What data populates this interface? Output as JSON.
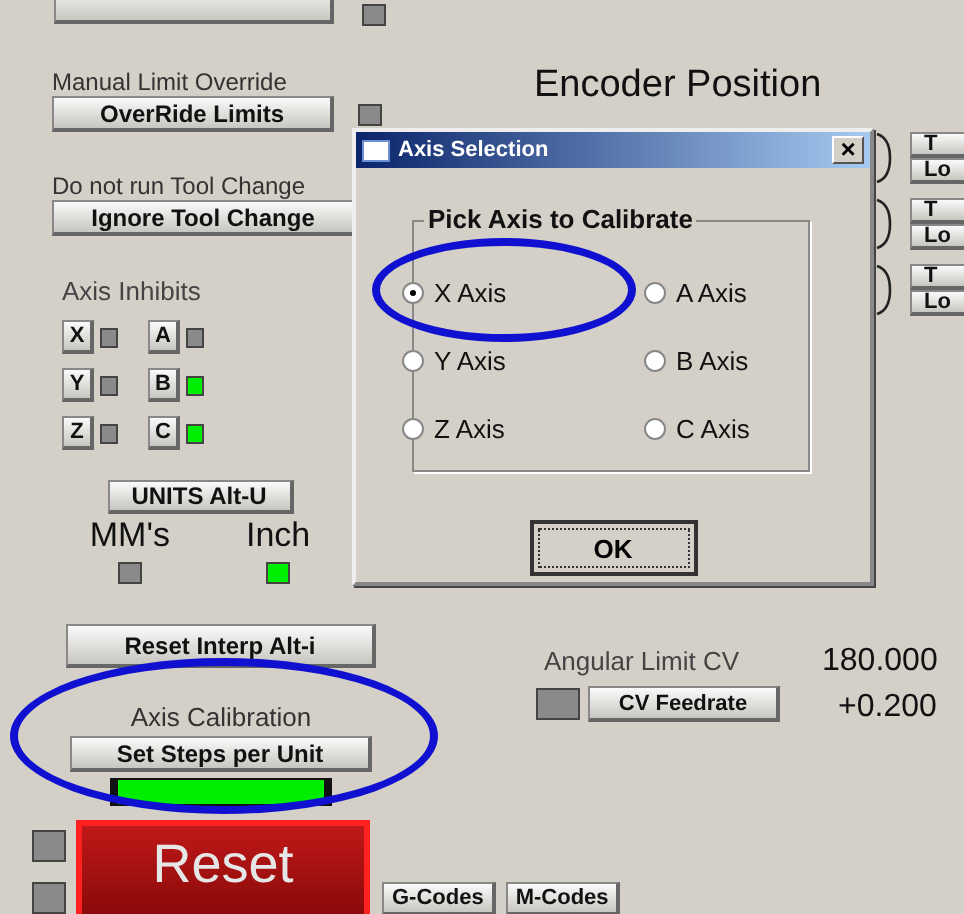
{
  "top_led": {
    "on": false
  },
  "limit_override": {
    "label": "Manual Limit Override",
    "button": "OverRide Limits",
    "led_on": false
  },
  "tool_change": {
    "label": "Do not run Tool Change",
    "button": "Ignore Tool Change"
  },
  "axis_inhibits": {
    "title": "Axis Inhibits",
    "axes": [
      {
        "label": "X",
        "on": false
      },
      {
        "label": "A",
        "on": false
      },
      {
        "label": "Y",
        "on": false
      },
      {
        "label": "B",
        "on": true
      },
      {
        "label": "Z",
        "on": false
      },
      {
        "label": "C",
        "on": true
      }
    ]
  },
  "units": {
    "button": "UNITS Alt-U",
    "options": [
      {
        "label": "MM's",
        "on": false
      },
      {
        "label": "Inch",
        "on": true
      }
    ]
  },
  "reset_interp": {
    "button": "Reset Interp Alt-i"
  },
  "axis_calibration": {
    "label": "Axis Calibration",
    "button": "Set Steps per Unit"
  },
  "reset": {
    "button": "Reset",
    "leds": [
      {
        "on": false
      },
      {
        "on": false
      }
    ]
  },
  "tabs": [
    {
      "label": "G-Codes"
    },
    {
      "label": "M-Codes"
    }
  ],
  "encoder": {
    "title": "Encoder Position",
    "buttons": [
      {
        "label": "T"
      },
      {
        "label": "Lo"
      },
      {
        "label": "T"
      },
      {
        "label": "Lo"
      },
      {
        "label": "T"
      },
      {
        "label": "Lo"
      }
    ]
  },
  "cv": {
    "label": "Angular Limit CV",
    "value": "180.000",
    "led_on": false,
    "button": "CV Feedrate",
    "readout": "+0.200"
  },
  "dialog": {
    "title": "Axis Selection",
    "close": "×",
    "group": "Pick Axis to Calibrate",
    "options": [
      {
        "label": "X Axis",
        "selected": true
      },
      {
        "label": "A Axis",
        "selected": false
      },
      {
        "label": "Y Axis",
        "selected": false
      },
      {
        "label": "B Axis",
        "selected": false
      },
      {
        "label": "Z Axis",
        "selected": false
      },
      {
        "label": "C Axis",
        "selected": false
      }
    ],
    "ok": "OK"
  }
}
